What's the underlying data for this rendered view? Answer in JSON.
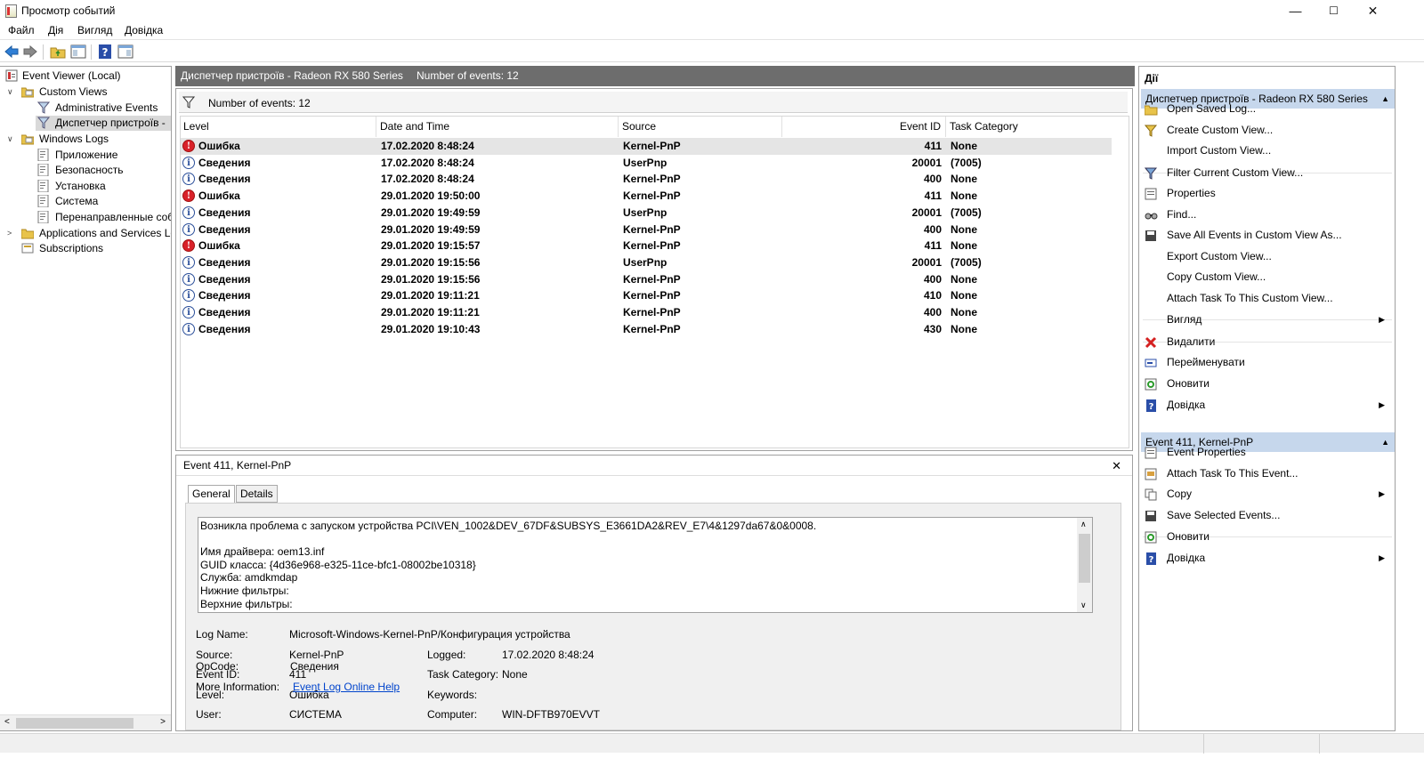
{
  "window": {
    "title": "Просмотр событий",
    "minimize": "—",
    "maximize": "☐",
    "close": "✕"
  },
  "menu": [
    "Файл",
    "Дія",
    "Вигляд",
    "Довідка"
  ],
  "toolbar": {
    "icons": [
      "back-icon",
      "forward-icon",
      "folder-up-icon",
      "console-tree-icon",
      "help-icon",
      "action-pane-icon"
    ]
  },
  "tree": {
    "root": "Event Viewer (Local)",
    "custom_views": "Custom Views",
    "admin_events": "Administrative Events",
    "device_manager_view": "Диспетчер пристроїв -",
    "windows_logs": "Windows Logs",
    "logs": [
      "Приложение",
      "Безопасность",
      "Установка",
      "Система",
      "Перенаправленные соб"
    ],
    "app_services": "Applications and Services Lo",
    "subscriptions": "Subscriptions"
  },
  "center": {
    "header_title": "Диспетчер пристроїв - Radeon RX 580 Series",
    "header_count": "Number of events: 12",
    "filter_text": "Number of events: 12",
    "columns": [
      "Level",
      "Date and Time",
      "Source",
      "Event ID",
      "Task Category"
    ],
    "rows": [
      {
        "level": "Ошибка",
        "type": "error",
        "date": "17.02.2020 8:48:24",
        "source": "Kernel-PnP",
        "id": "411",
        "cat": "None"
      },
      {
        "level": "Сведения",
        "type": "info",
        "date": "17.02.2020 8:48:24",
        "source": "UserPnp",
        "id": "20001",
        "cat": "(7005)"
      },
      {
        "level": "Сведения",
        "type": "info",
        "date": "17.02.2020 8:48:24",
        "source": "Kernel-PnP",
        "id": "400",
        "cat": "None"
      },
      {
        "level": "Ошибка",
        "type": "error",
        "date": "29.01.2020 19:50:00",
        "source": "Kernel-PnP",
        "id": "411",
        "cat": "None"
      },
      {
        "level": "Сведения",
        "type": "info",
        "date": "29.01.2020 19:49:59",
        "source": "UserPnp",
        "id": "20001",
        "cat": "(7005)"
      },
      {
        "level": "Сведения",
        "type": "info",
        "date": "29.01.2020 19:49:59",
        "source": "Kernel-PnP",
        "id": "400",
        "cat": "None"
      },
      {
        "level": "Ошибка",
        "type": "error",
        "date": "29.01.2020 19:15:57",
        "source": "Kernel-PnP",
        "id": "411",
        "cat": "None"
      },
      {
        "level": "Сведения",
        "type": "info",
        "date": "29.01.2020 19:15:56",
        "source": "UserPnp",
        "id": "20001",
        "cat": "(7005)"
      },
      {
        "level": "Сведения",
        "type": "info",
        "date": "29.01.2020 19:15:56",
        "source": "Kernel-PnP",
        "id": "400",
        "cat": "None"
      },
      {
        "level": "Сведения",
        "type": "info",
        "date": "29.01.2020 19:11:21",
        "source": "Kernel-PnP",
        "id": "410",
        "cat": "None"
      },
      {
        "level": "Сведения",
        "type": "info",
        "date": "29.01.2020 19:11:21",
        "source": "Kernel-PnP",
        "id": "400",
        "cat": "None"
      },
      {
        "level": "Сведения",
        "type": "info",
        "date": "29.01.2020 19:10:43",
        "source": "Kernel-PnP",
        "id": "430",
        "cat": "None"
      }
    ]
  },
  "detail": {
    "title": "Event 411, Kernel-PnP",
    "close": "✕",
    "tabs": [
      "General",
      "Details"
    ],
    "description_lines": [
      "Возникла проблема с запуском устройства PCI\\VEN_1002&DEV_67DF&SUBSYS_E3661DA2&REV_E7\\4&1297da67&0&0008.",
      "",
      "Имя драйвера: oem13.inf",
      "GUID класса: {4d36e968-e325-11ce-bfc1-08002be10318}",
      "Служба: amdkmdap",
      "Нижние фильтры:",
      "Верхние фильтры:"
    ],
    "log_name_label": "Log Name:",
    "log_name": "Microsoft-Windows-Kernel-PnP/Конфигурация устройства",
    "source_label": "Source:",
    "source": "Kernel-PnP",
    "logged_label": "Logged:",
    "logged": "17.02.2020 8:48:24",
    "event_id_label": "Event ID:",
    "event_id": "411",
    "task_label": "Task Category:",
    "task": "None",
    "level_label": "Level:",
    "level": "Ошибка",
    "keywords_label": "Keywords:",
    "keywords": "",
    "user_label": "User:",
    "user": "СИСТЕМА",
    "computer_label": "Computer:",
    "computer": "WIN-DFTB970EVVT",
    "opcode_label": "OpCode:",
    "opcode": "Сведения",
    "more_label": "More Information:",
    "more_link": "Event Log Online Help"
  },
  "actions": {
    "header": "Дії",
    "section1": "Диспетчер пристроїв - Radeon RX 580 Series",
    "items1": [
      "Open Saved Log...",
      "Create Custom View...",
      "Import Custom View...",
      "Filter Current Custom View...",
      "Properties",
      "Find...",
      "Save All Events in Custom View As...",
      "Export Custom View...",
      "Copy Custom View...",
      "Attach Task To This Custom View...",
      "Вигляд",
      "Видалити",
      "Перейменувати",
      "Оновити",
      "Довідка"
    ],
    "section2": "Event 411, Kernel-PnP",
    "items2": [
      "Event Properties",
      "Attach Task To This Event...",
      "Copy",
      "Save Selected Events...",
      "Оновити",
      "Довідка"
    ]
  }
}
